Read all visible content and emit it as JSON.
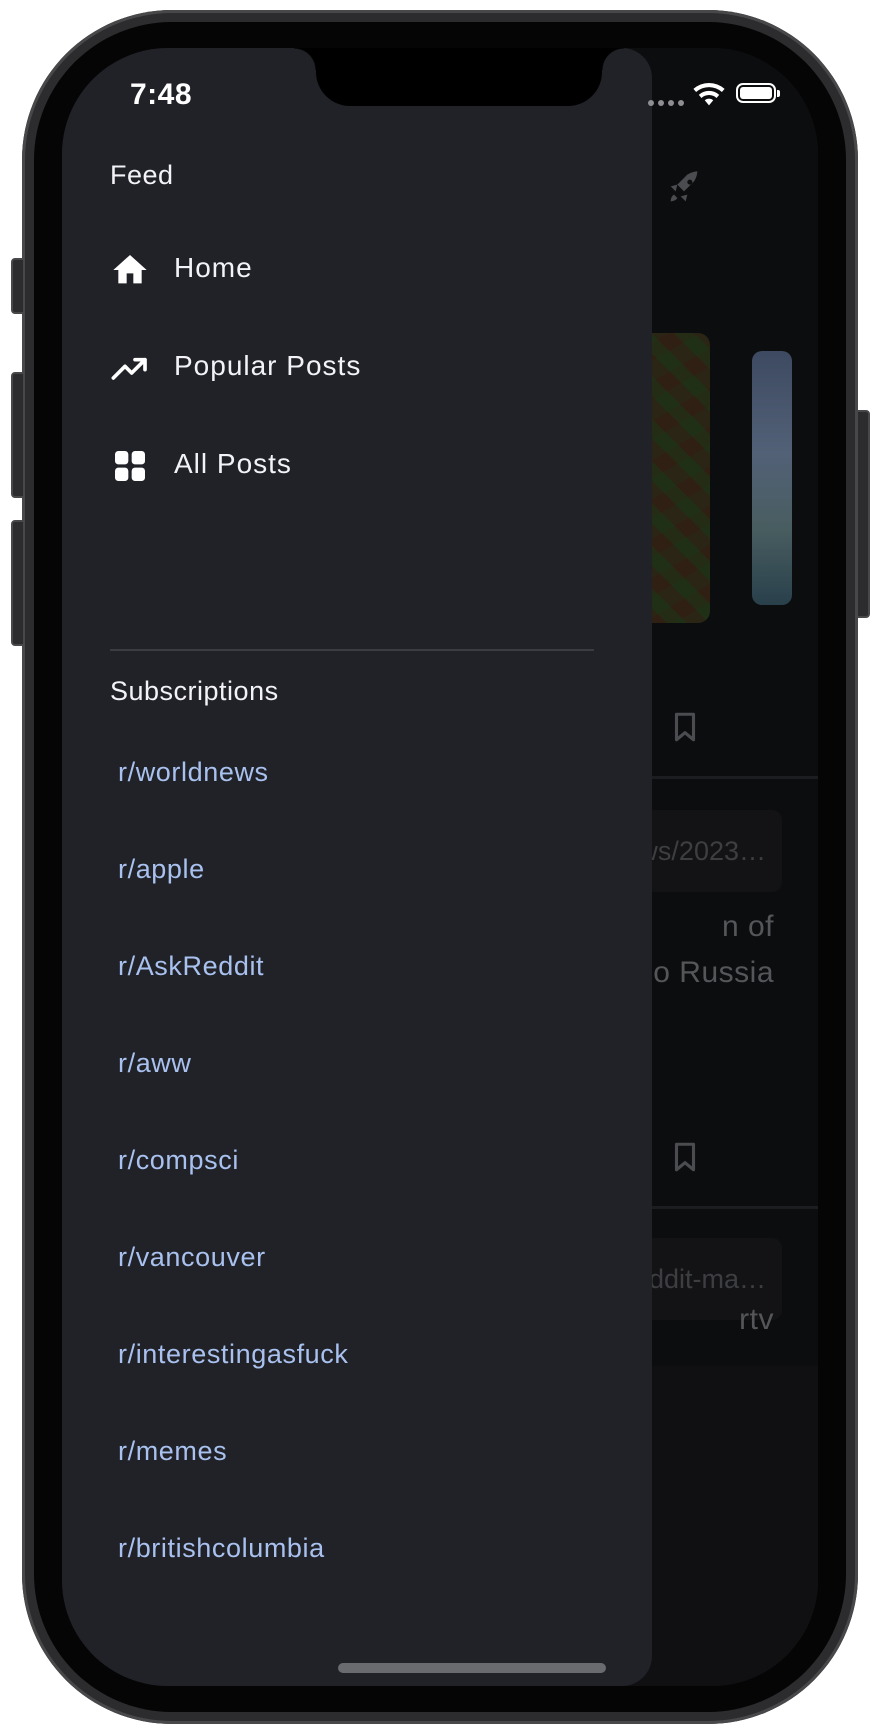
{
  "status_bar": {
    "time": "7:48"
  },
  "drawer": {
    "feed_heading": "Feed",
    "feed_items": [
      {
        "label": "Home",
        "icon": "home-icon"
      },
      {
        "label": "Popular Posts",
        "icon": "trending-up-icon"
      },
      {
        "label": "All Posts",
        "icon": "grid-icon"
      }
    ],
    "subscriptions_heading": "Subscriptions",
    "subscriptions": [
      "r/worldnews",
      "r/apple",
      "r/AskReddit",
      "r/aww",
      "r/compsci",
      "r/vancouver",
      "r/interestingasfuck",
      "r/memes",
      "r/britishcolumbia"
    ]
  },
  "background_feed": {
    "link_1": "ws/2023…",
    "title_1_line_1": "n of",
    "title_1_line_2": "o Russia",
    "link_2": "ddit-ma…",
    "title_2_line_1": "rtv"
  },
  "colors": {
    "drawer_background": "#202227",
    "subscription_link": "#a9c1ef",
    "feed_background": "#131417"
  }
}
